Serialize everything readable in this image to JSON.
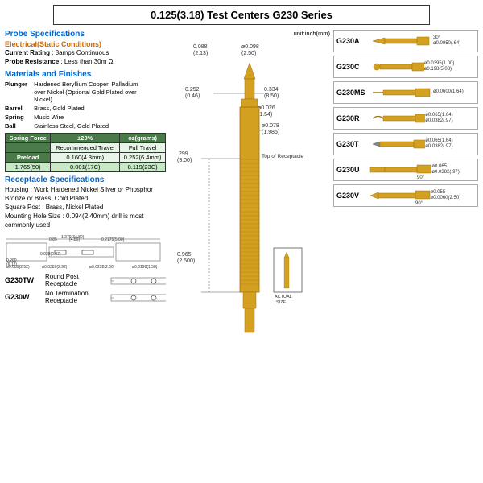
{
  "title": "0.125(3.18) Test Centers G230 Series",
  "probeSpecs": {
    "heading": "Probe Specifications",
    "electrical": {
      "label": "Electrical(Static Conditions)",
      "current": {
        "label": "Current Rating",
        "value": ": 8amps Continuous"
      },
      "resistance": {
        "label": "Probe Resistance",
        "value": ": Less than 30m Ω"
      }
    }
  },
  "materials": {
    "heading": "Materials and Finishes",
    "rows": [
      {
        "label": "Plunger",
        "value": "Hardened Beryllium Copper, Palladium over Nickel (Optional Gold Plated over Nickel)"
      },
      {
        "label": "Barrel",
        "value": "Brass, Gold Plated"
      },
      {
        "label": "Spring",
        "value": "Music Wire"
      },
      {
        "label": "Ball",
        "value": "Stainless Steel, Gold Plated"
      }
    ]
  },
  "springForce": {
    "header1": "Spring Force",
    "header2": "±20%",
    "header3": "oz(grams)",
    "col1": "Recommended Travel",
    "col2": "Full Travel",
    "row1label": "Preload",
    "row1v1": "0.160(4.3mm)",
    "row1v2": "0.252(6.4mm)",
    "row2label": "1.765(50)",
    "row2v1": "0.001(17C)",
    "row2v2": "8.119(23C)"
  },
  "receptacle": {
    "heading": "Receptacle Specifications",
    "housing": "Housing : Work Hardened Nickel Silver or Phosphor Bronze or Brass, Cold Plated",
    "square": "Square Post : Brass, Nickel Plated",
    "mounting": "Mounting Hole Size : 0.094(2.40mm) drill is most commonly used"
  },
  "diagrams": {
    "unit": "unit:inch(mm)",
    "dims": {
      "d1": "0.088(2.13)",
      "d2": "ø0.098(2.50)",
      "d3": "0.252(0.46)",
      "d4": "0.334(8.50)",
      "d5": "ø0.026(1.54)",
      "d6": "ø0.078(1.985)",
      "d7": ".299(3.00)",
      "d8": "0.965(2.500)",
      "topLabel": "Top of Receptacle",
      "actualSize": "ACTUAL SIZE"
    }
  },
  "bottomModels": [
    {
      "id": "G230TW",
      "desc": "Round Post Receptacle"
    },
    {
      "id": "G230W",
      "desc": "No Termination Receptacle"
    }
  ],
  "rightModels": [
    {
      "id": "G230A",
      "angle": "30°",
      "dims": "ø0.0950(.64)"
    },
    {
      "id": "G230C",
      "angle": "",
      "dims": "ø0.0395(1.00)\nø0.198(5.03)"
    },
    {
      "id": "G230MS",
      "angle": "",
      "dims": "ø0.0600(1.64)"
    },
    {
      "id": "G230R",
      "angle": "",
      "dims": "ø0.065(1.64)\nø0.0382(.97)"
    },
    {
      "id": "G230T",
      "angle": "",
      "dims": "ø0.065(1.64)\nø0.0382(.97)"
    },
    {
      "id": "G230U",
      "angle": "90°",
      "dims": "ø0.065\nø0.0382(.97)"
    },
    {
      "id": "G230V",
      "angle": "90°",
      "dims": "ø0.055\nø0.0060(2.50)"
    }
  ],
  "colors": {
    "blue": "#0066cc",
    "orange": "#cc6600",
    "green": "#3a6e3a",
    "lightGreen": "#e8f4e8",
    "gold": "#c8a020"
  }
}
